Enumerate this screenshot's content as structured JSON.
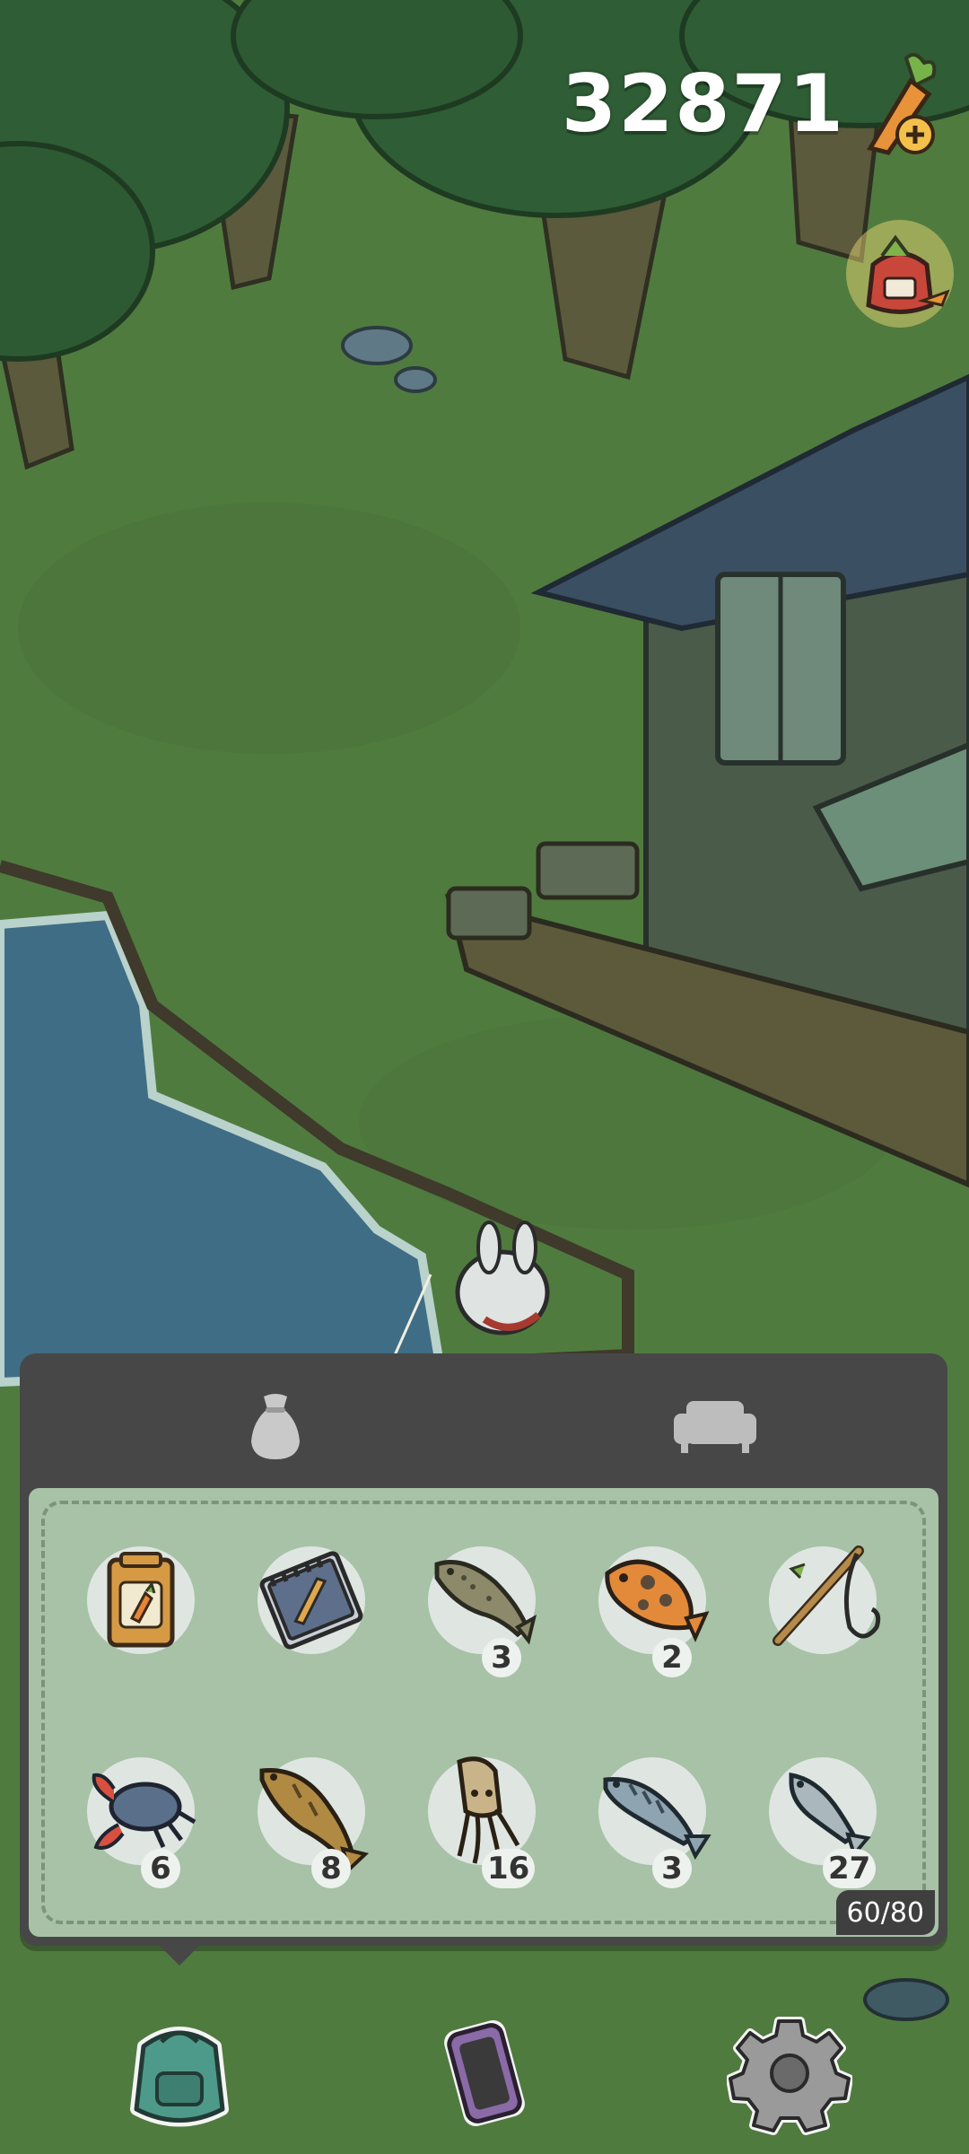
{
  "currency": {
    "value": "32871",
    "icon": "carrot-plus-icon"
  },
  "gift": {
    "icon": "carrot-gift-bag-icon"
  },
  "inventory": {
    "tabs": [
      {
        "icon": "bag-icon",
        "active": true
      },
      {
        "icon": "sofa-icon",
        "active": false
      }
    ],
    "capacity": "60/80",
    "items": [
      {
        "icon": "carrot-seed-packet-icon",
        "count": ""
      },
      {
        "icon": "notebook-icon",
        "count": ""
      },
      {
        "icon": "catfish-icon",
        "count": "3"
      },
      {
        "icon": "orange-fish-icon",
        "count": "2"
      },
      {
        "icon": "fishing-rod-icon",
        "count": ""
      },
      {
        "icon": "crab-icon",
        "count": "6"
      },
      {
        "icon": "golden-fish-icon",
        "count": "8"
      },
      {
        "icon": "squid-icon",
        "count": "16"
      },
      {
        "icon": "mackerel-icon",
        "count": "3"
      },
      {
        "icon": "small-fish-icon",
        "count": "27"
      }
    ]
  },
  "nav": [
    {
      "icon": "backpack-icon"
    },
    {
      "icon": "phone-icon"
    },
    {
      "icon": "settings-gear-icon"
    }
  ],
  "colors": {
    "grass": "#4f7a3e",
    "water": "#3f6d85",
    "panel": "#474747",
    "grid": "#a7c2a6"
  }
}
